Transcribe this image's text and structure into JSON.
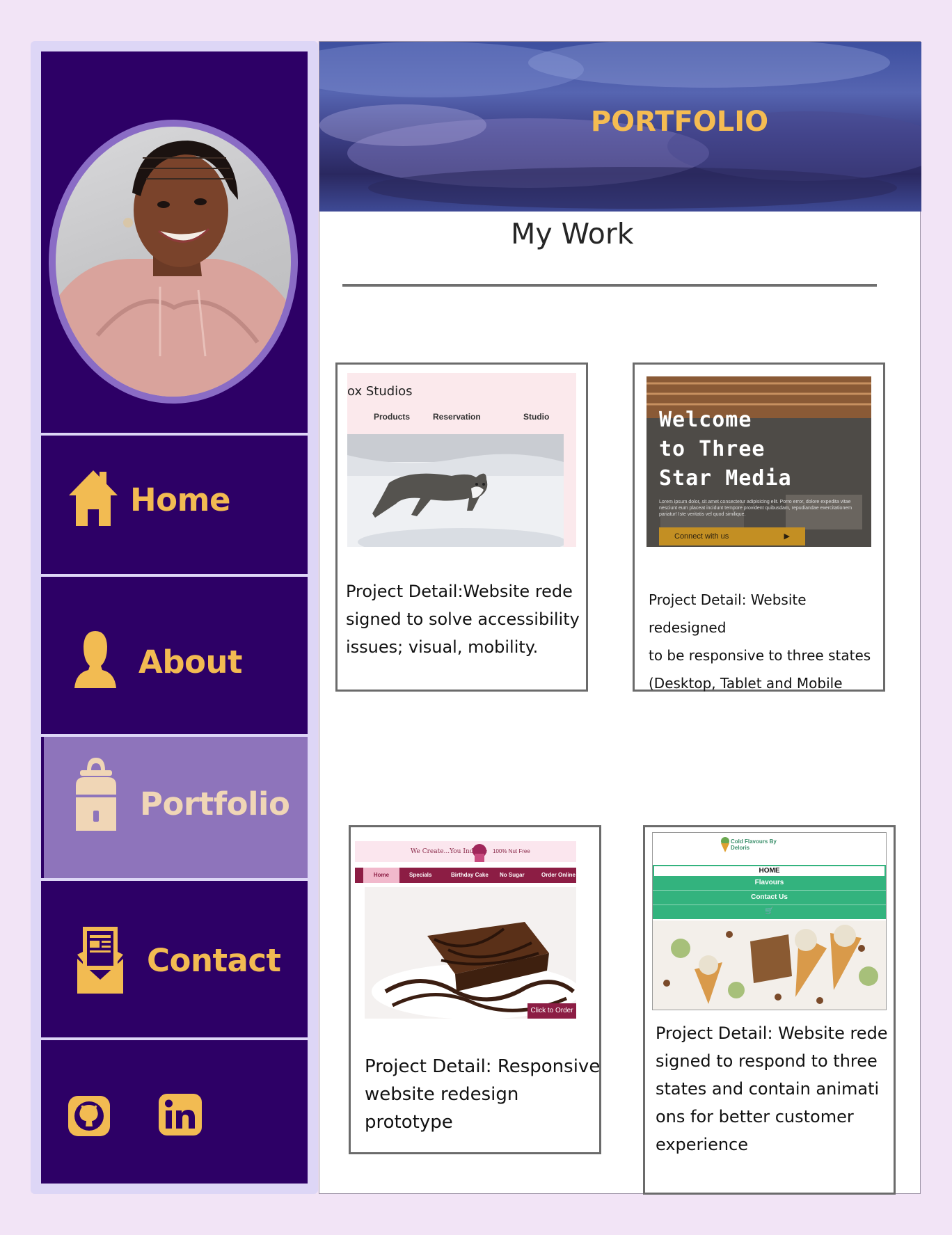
{
  "sidebar": {
    "nav": [
      {
        "label": "Home",
        "icon": "house-icon"
      },
      {
        "label": "About",
        "icon": "person-icon"
      },
      {
        "label": "Portfolio",
        "icon": "backpack-icon"
      },
      {
        "label": "Contact",
        "icon": "envelope-document-icon"
      }
    ],
    "active": "Portfolio",
    "social": [
      {
        "icon": "github-icon"
      },
      {
        "icon": "linkedin-icon"
      }
    ]
  },
  "header": {
    "title": "PORTFOLIO"
  },
  "main": {
    "section_title": "My Work",
    "projects": [
      {
        "description": "Project Detail:Website rede\nsigned to solve accessibility\n issues; visual, mobility.",
        "thumb": {
          "brand": "ox Studios",
          "menu": [
            "Products",
            "Reservation",
            "Studio"
          ]
        }
      },
      {
        "description": "Project Detail: Website redesigned\n to be responsive to three states\n (Desktop, Tablet and Mobile",
        "thumb": {
          "headline": [
            "Welcome",
            "to Three",
            "Star Media"
          ],
          "body": "Lorem ipsum dolor, sit amet consectetur adipisicing elit. Porro error, dolore expedita vitae nesciunt eum placeat incidunt tempore provident quibusdam, repudiandae exercitationem pariatur! Iste veritatis vel quod similique.",
          "cta": "Connect with us"
        }
      },
      {
        "description": "Project Detail: Responsive\n website redesign\n prototype",
        "thumb": {
          "tagline": "We Create...You Indulge",
          "badge": "100% Nut Free",
          "menu": [
            "Home",
            "Specials",
            "Birthday Cake",
            "No Sugar",
            "Order Online"
          ],
          "cta": "Click to Order"
        }
      },
      {
        "description": "Project Detail: Website rede\nsigned to respond to three\nstates and contain animati\nons for better customer\nexperience",
        "thumb": {
          "brand": "Cold Flavours By Deloris",
          "menu": [
            "HOME",
            "Flavours",
            "Contact Us"
          ]
        }
      }
    ]
  },
  "colors": {
    "sidebar_bg": "#2d0066",
    "sidebar_active": "#8e74bb",
    "accent": "#f2bb52",
    "page_bg": "#f2e4f6"
  }
}
